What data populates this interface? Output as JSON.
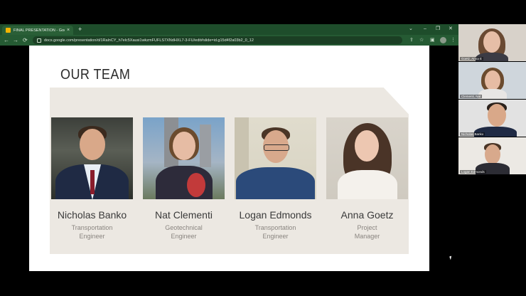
{
  "browser": {
    "tab_title": "FINAL PRESENTATION - Google",
    "tab_close": "×",
    "new_tab": "+",
    "url": "docs.google.com/presentation/d/1RalnCY_h7elc5Xausi1wkzmFUFLS7XNdHXL7-3-FU/edit#slide=id.g15d4f2a03b2_0_12",
    "icons": {
      "back": "←",
      "forward": "→",
      "reload": "⟳",
      "share": "⇪",
      "star": "☆",
      "extensions": "▣",
      "menu": "⋮",
      "minimize": "–",
      "maximize": "❐",
      "close": "✕",
      "tabs_dropdown": "⌄"
    }
  },
  "slide": {
    "title": "OUR TEAM",
    "members": [
      {
        "name": "Nicholas Banko",
        "role_line1": "Transportation",
        "role_line2": "Engineer"
      },
      {
        "name": "Nat Clementi",
        "role_line1": "Geotechnical",
        "role_line2": "Engineer"
      },
      {
        "name": "Logan Edmonds",
        "role_line1": "Transportation",
        "role_line2": "Engineer"
      },
      {
        "name": "Anna Goetz",
        "role_line1": "Project",
        "role_line2": "Manager"
      }
    ]
  },
  "participants": [
    {
      "label": "Goetz, Anna E"
    },
    {
      "label": "Clementi, Nat"
    },
    {
      "label": "Nicholas Banko"
    },
    {
      "label": "Logan Edmonds"
    }
  ],
  "colors": {
    "browser_frame": "#1e4d2b",
    "slide_panel": "#ece8e2",
    "title_text": "#2b2b2b"
  }
}
